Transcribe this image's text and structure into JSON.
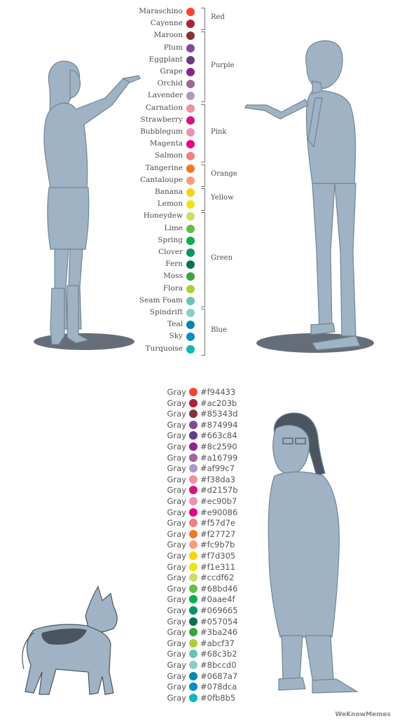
{
  "top_colors": [
    {
      "name": "Maraschino",
      "color": "#f94433"
    },
    {
      "name": "Cayenne",
      "color": "#ac203b"
    },
    {
      "name": "Maroon",
      "color": "#85343d"
    },
    {
      "name": "Plum",
      "color": "#874994"
    },
    {
      "name": "Eggplant",
      "color": "#663c84"
    },
    {
      "name": "Grape",
      "color": "#8c2590"
    },
    {
      "name": "Orchid",
      "color": "#a16799"
    },
    {
      "name": "Lavender",
      "color": "#af99c7"
    },
    {
      "name": "Carnation",
      "color": "#f38da3"
    },
    {
      "name": "Strawberry",
      "color": "#d2157b"
    },
    {
      "name": "Bubblegum",
      "color": "#ec90b7"
    },
    {
      "name": "Magenta",
      "color": "#e90086"
    },
    {
      "name": "Salmon",
      "color": "#f57d7e"
    },
    {
      "name": "Tangerine",
      "color": "#f27727"
    },
    {
      "name": "Cantaloupe",
      "color": "#fc9b7b"
    },
    {
      "name": "Banana",
      "color": "#f7d305"
    },
    {
      "name": "Lemon",
      "color": "#f1e311"
    },
    {
      "name": "Honeydew",
      "color": "#ccdf62"
    },
    {
      "name": "Lime",
      "color": "#68bd46"
    },
    {
      "name": "Spring",
      "color": "#0aae4f"
    },
    {
      "name": "Clover",
      "color": "#069665"
    },
    {
      "name": "Fern",
      "color": "#057054"
    },
    {
      "name": "Moss",
      "color": "#3ba246"
    },
    {
      "name": "Flora",
      "color": "#abcf37"
    },
    {
      "name": "Seam Foam",
      "color": "#68c3b2"
    },
    {
      "name": "Spindrift",
      "color": "#8bccd0"
    },
    {
      "name": "Teal",
      "color": "#0687a7"
    },
    {
      "name": "Sky",
      "color": "#078dca"
    },
    {
      "name": "Turquoise",
      "color": "#0fb8b5"
    }
  ],
  "groups": [
    {
      "label": "Red",
      "start": 0,
      "end": 1
    },
    {
      "label": "Purple",
      "start": 2,
      "end": 7
    },
    {
      "label": "Pink",
      "start": 8,
      "end": 12
    },
    {
      "label": "Orange",
      "start": 13,
      "end": 14
    },
    {
      "label": "Yellow",
      "start": 15,
      "end": 16
    },
    {
      "label": "Green",
      "start": 17,
      "end": 24
    },
    {
      "label": "Blue",
      "start": 25,
      "end": 28
    }
  ],
  "bottom_colors": [
    {
      "label": "Gray",
      "hex": "#f94433"
    },
    {
      "label": "Gray",
      "hex": "#ac203b"
    },
    {
      "label": "Gray",
      "hex": "#85343d"
    },
    {
      "label": "Gray",
      "hex": "#874994"
    },
    {
      "label": "Gray",
      "hex": "#663c84"
    },
    {
      "label": "Gray",
      "hex": "#8c2590"
    },
    {
      "label": "Gray",
      "hex": "#a16799"
    },
    {
      "label": "Gray",
      "hex": "#af99c7"
    },
    {
      "label": "Gray",
      "hex": "#f38da3"
    },
    {
      "label": "Gray",
      "hex": "#d2157b"
    },
    {
      "label": "Gray",
      "hex": "#ec90b7"
    },
    {
      "label": "Gray",
      "hex": "#e90086"
    },
    {
      "label": "Gray",
      "hex": "#f57d7e"
    },
    {
      "label": "Gray",
      "hex": "#f27727"
    },
    {
      "label": "Gray",
      "hex": "#fc9b7b"
    },
    {
      "label": "Gray",
      "hex": "#f7d305"
    },
    {
      "label": "Gray",
      "hex": "#f1e311"
    },
    {
      "label": "Gray",
      "hex": "#ccdf62"
    },
    {
      "label": "Gray",
      "hex": "#68bd46"
    },
    {
      "label": "Gray",
      "hex": "#0aae4f"
    },
    {
      "label": "Gray",
      "hex": "#069665"
    },
    {
      "label": "Gray",
      "hex": "#057054"
    },
    {
      "label": "Gray",
      "hex": "#3ba246"
    },
    {
      "label": "Gray",
      "hex": "#abcf37"
    },
    {
      "label": "Gray",
      "hex": "#68c3b2"
    },
    {
      "label": "Gray",
      "hex": "#8bccd0"
    },
    {
      "label": "Gray",
      "hex": "#0687a7"
    },
    {
      "label": "Gray",
      "hex": "#078dca"
    },
    {
      "label": "Gray",
      "hex": "#0fb8b5"
    }
  ],
  "figure_color": "#9fb3c4",
  "figure_outline": "#6f8596",
  "shadow_color": "#4a5560",
  "watermark": "WeKnowMemes"
}
